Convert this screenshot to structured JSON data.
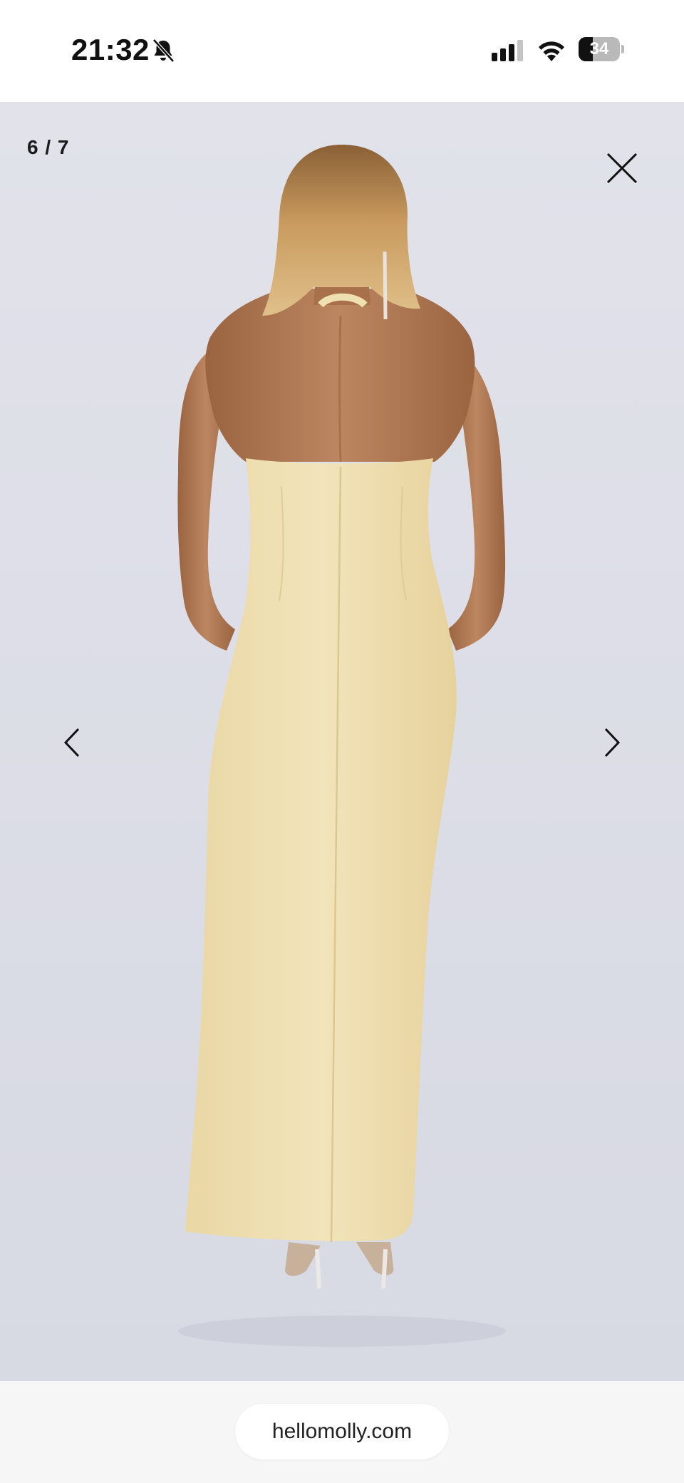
{
  "status_bar": {
    "time": "21:32",
    "battery_percent": "34",
    "battery_level": 0.34,
    "icons": [
      "bell-slash-icon",
      "cellular-signal-icon",
      "wifi-icon",
      "battery-icon"
    ]
  },
  "viewer": {
    "counter": "6 / 7",
    "icons": [
      "close-icon",
      "chevron-left-icon",
      "chevron-right-icon"
    ],
    "colors": {
      "background": "#dcdee8",
      "dress": "#efe0b2",
      "skin": "#b07a55",
      "hair": "#b98a52"
    }
  },
  "browser": {
    "url": "hellomolly.com"
  }
}
